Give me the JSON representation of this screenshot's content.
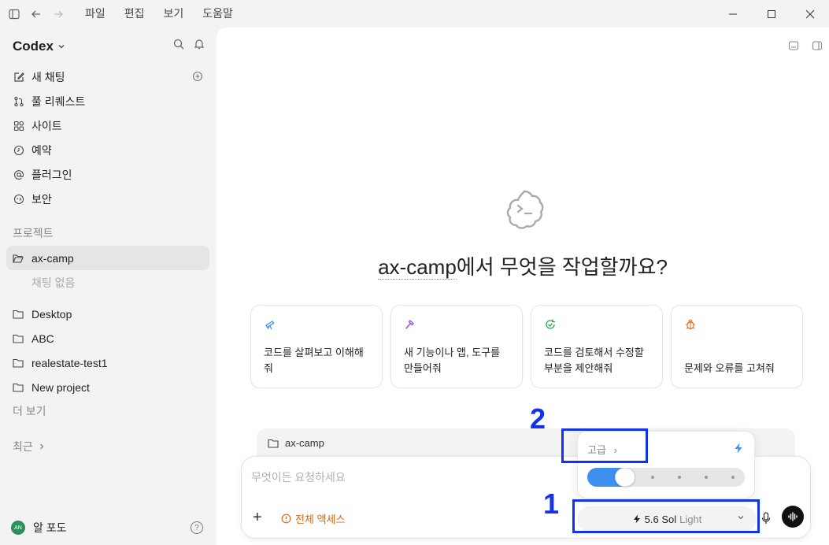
{
  "menu": [
    "파일",
    "편집",
    "보기",
    "도움말"
  ],
  "sidebar": {
    "brand": "Codex",
    "nav": [
      {
        "label": "새 채팅",
        "icon": "edit-icon"
      },
      {
        "label": "풀 리퀘스트",
        "icon": "pull-request-icon"
      },
      {
        "label": "사이트",
        "icon": "grid-icon"
      },
      {
        "label": "예약",
        "icon": "clock-icon"
      },
      {
        "label": "플러그인",
        "icon": "at-icon"
      },
      {
        "label": "보안",
        "icon": "shield-icon"
      }
    ],
    "projects_label": "프로젝트",
    "active_project": "ax-camp",
    "empty_chats": "채팅 없음",
    "projects": [
      "Desktop",
      "ABC",
      "realestate-test1",
      "New project"
    ],
    "more": "더 보기",
    "recent": "최근",
    "user_initials": "AN",
    "user_name": "알 포도"
  },
  "main": {
    "hero_project": "ax-camp",
    "hero_rest": "에서 무엇을 작업할까요?",
    "cards": [
      {
        "text": "코드를 살펴보고 이해해줘",
        "icon": "telescope-icon",
        "color": "#3d8ff0"
      },
      {
        "text": "새 기능이나 앱, 도구를 만들어줘",
        "icon": "hammer-icon",
        "color": "#9b4de0"
      },
      {
        "text": "코드를 검토해서 수정할 부분을 제안해줘",
        "icon": "review-icon",
        "color": "#2fa24e"
      },
      {
        "text": "문제와 오류를 고쳐줘",
        "icon": "bug-icon",
        "color": "#e0782a"
      }
    ],
    "context_project": "ax-camp",
    "composer": {
      "placeholder": "무엇이든 요청하세요",
      "access": "전체 액세스",
      "model": "5.6 Sol",
      "model_level": "Light"
    },
    "popover": {
      "advanced": "고급",
      "level_fraction": 0.2
    }
  },
  "annotations": {
    "one": "1",
    "two": "2"
  }
}
